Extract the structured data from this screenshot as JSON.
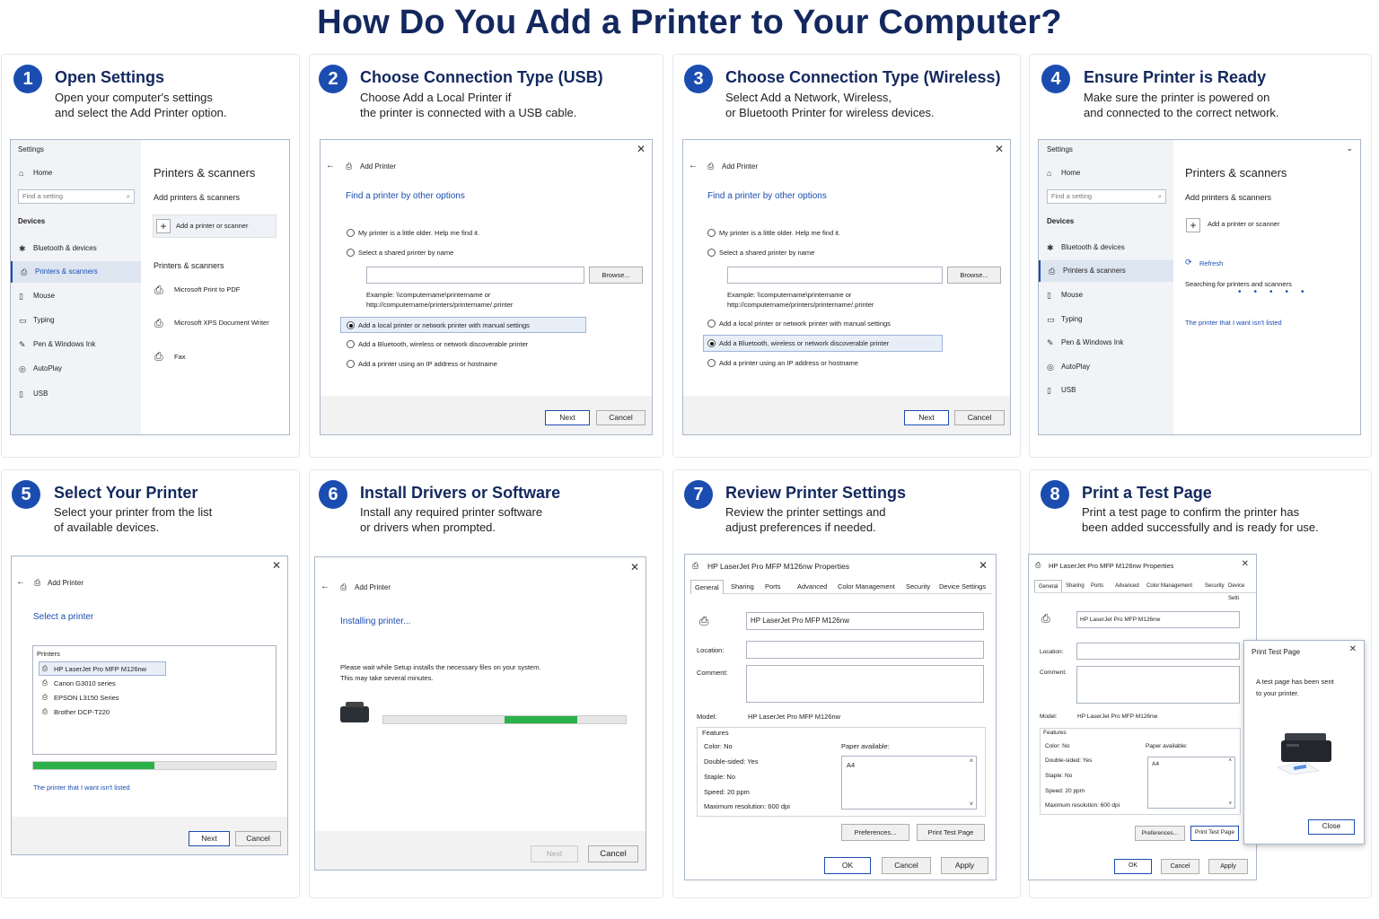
{
  "title": "How Do You Add a Printer to Your Computer?",
  "steps": [
    {
      "n": "1",
      "title": "Open Settings",
      "desc": "Open your computer's settings\nand select the Add Printer option."
    },
    {
      "n": "2",
      "title": "Choose Connection Type (USB)",
      "desc": "Choose Add a Local Printer if\nthe printer is connected with a USB cable."
    },
    {
      "n": "3",
      "title": "Choose Connection Type (Wireless)",
      "desc": "Select Add a Network, Wireless,\nor Bluetooth Printer for wireless devices."
    },
    {
      "n": "4",
      "title": "Ensure Printer is Ready",
      "desc": "Make sure the printer is powered on\nand connected to the correct network."
    },
    {
      "n": "5",
      "title": "Select Your Printer",
      "desc": "Select your printer from the list\nof available devices."
    },
    {
      "n": "6",
      "title": "Install Drivers or Software",
      "desc": "Install any required printer software\nor drivers when prompted."
    },
    {
      "n": "7",
      "title": "Review Printer Settings",
      "desc": "Review the printer settings and\nadjust preferences if needed."
    },
    {
      "n": "8",
      "title": "Print a Test Page",
      "desc": "Print a test page to confirm the printer has\nbeen added successfully and is ready for use."
    }
  ],
  "settings": {
    "window_title": "Settings",
    "home": "Home",
    "search_placeholder": "Find a setting",
    "devices": "Devices",
    "nav": [
      "Bluetooth & devices",
      "Printers & scanners",
      "Mouse",
      "Typing",
      "Pen & Windows Ink",
      "AutoPlay",
      "USB"
    ],
    "heading": "Printers & scanners",
    "add_heading": "Add printers & scanners",
    "add_button": "Add a printer or scanner",
    "list_heading": "Printers & scanners",
    "printers": [
      "Microsoft Print to PDF",
      "Microsoft XPS Document Writer",
      "Fax"
    ],
    "refresh": "Refresh",
    "searching": "Searching for printers and scanners",
    "not_listed": "The printer that I want isn't listed"
  },
  "wizard": {
    "title": "Add Printer",
    "find_heading": "Find a printer by other options",
    "options": [
      "My printer is a little older. Help me find it.",
      "Select a shared printer by name",
      "Add a local printer or network printer with manual settings",
      "Add a Bluetooth, wireless or network discoverable printer",
      "Add a printer using an IP address or hostname"
    ],
    "browse": "Browse...",
    "example": "Example: \\\\computername\\printername or",
    "example_url": "http://computername/printers/printername/.printer",
    "next": "Next",
    "cancel": "Cancel",
    "select_heading": "Select a printer",
    "printers_label": "Printers",
    "found_printers": [
      "HP LaserJet Pro MFP M126nw",
      "Canon G3010 series",
      "EPSON L3150 Series",
      "Brother DCP-T220"
    ],
    "select_progress": 0.5,
    "not_listed": "The printer that I want isn't listed",
    "installing": "Installing printer...",
    "install_msg1": "Please wait while Setup installs the necessary files on your system.",
    "install_msg2": "This may take several minutes.",
    "install_progress": [
      0.5,
      0.8
    ]
  },
  "props": {
    "title": "HP LaserJet Pro MFP M126nw Properties",
    "tabs": [
      "General",
      "Sharing",
      "Ports",
      "Advanced",
      "Color Management",
      "Security",
      "Device Settings"
    ],
    "tabs_short": [
      "General",
      "Sharing",
      "Ports",
      "Advanced",
      "Color Management",
      "Security",
      "Device Setti"
    ],
    "name": "HP LaserJet Pro MFP M126nw",
    "location_label": "Location:",
    "comment_label": "Comment:",
    "model_label": "Model:",
    "model": "HP LaserJet Pro MFP M126nw",
    "features_label": "Features",
    "color": "Color: No",
    "duplex": "Double-sided: Yes",
    "staple": "Staple: No",
    "speed": "Speed: 20 ppm",
    "resolution": "Maximum resolution: 600 dpi",
    "paper_label": "Paper available:",
    "paper": "A4",
    "preferences": "Preferences...",
    "print_test": "Print Test Page",
    "ok": "OK",
    "cancel": "Cancel",
    "apply": "Apply",
    "test_title": "Print Test Page",
    "test_msg1": "A test page has been sent",
    "test_msg2": "to your printer.",
    "close": "Close"
  },
  "colors": {
    "navy": "#13285e",
    "accent": "#1b4db1",
    "progress": "#2db14a"
  }
}
